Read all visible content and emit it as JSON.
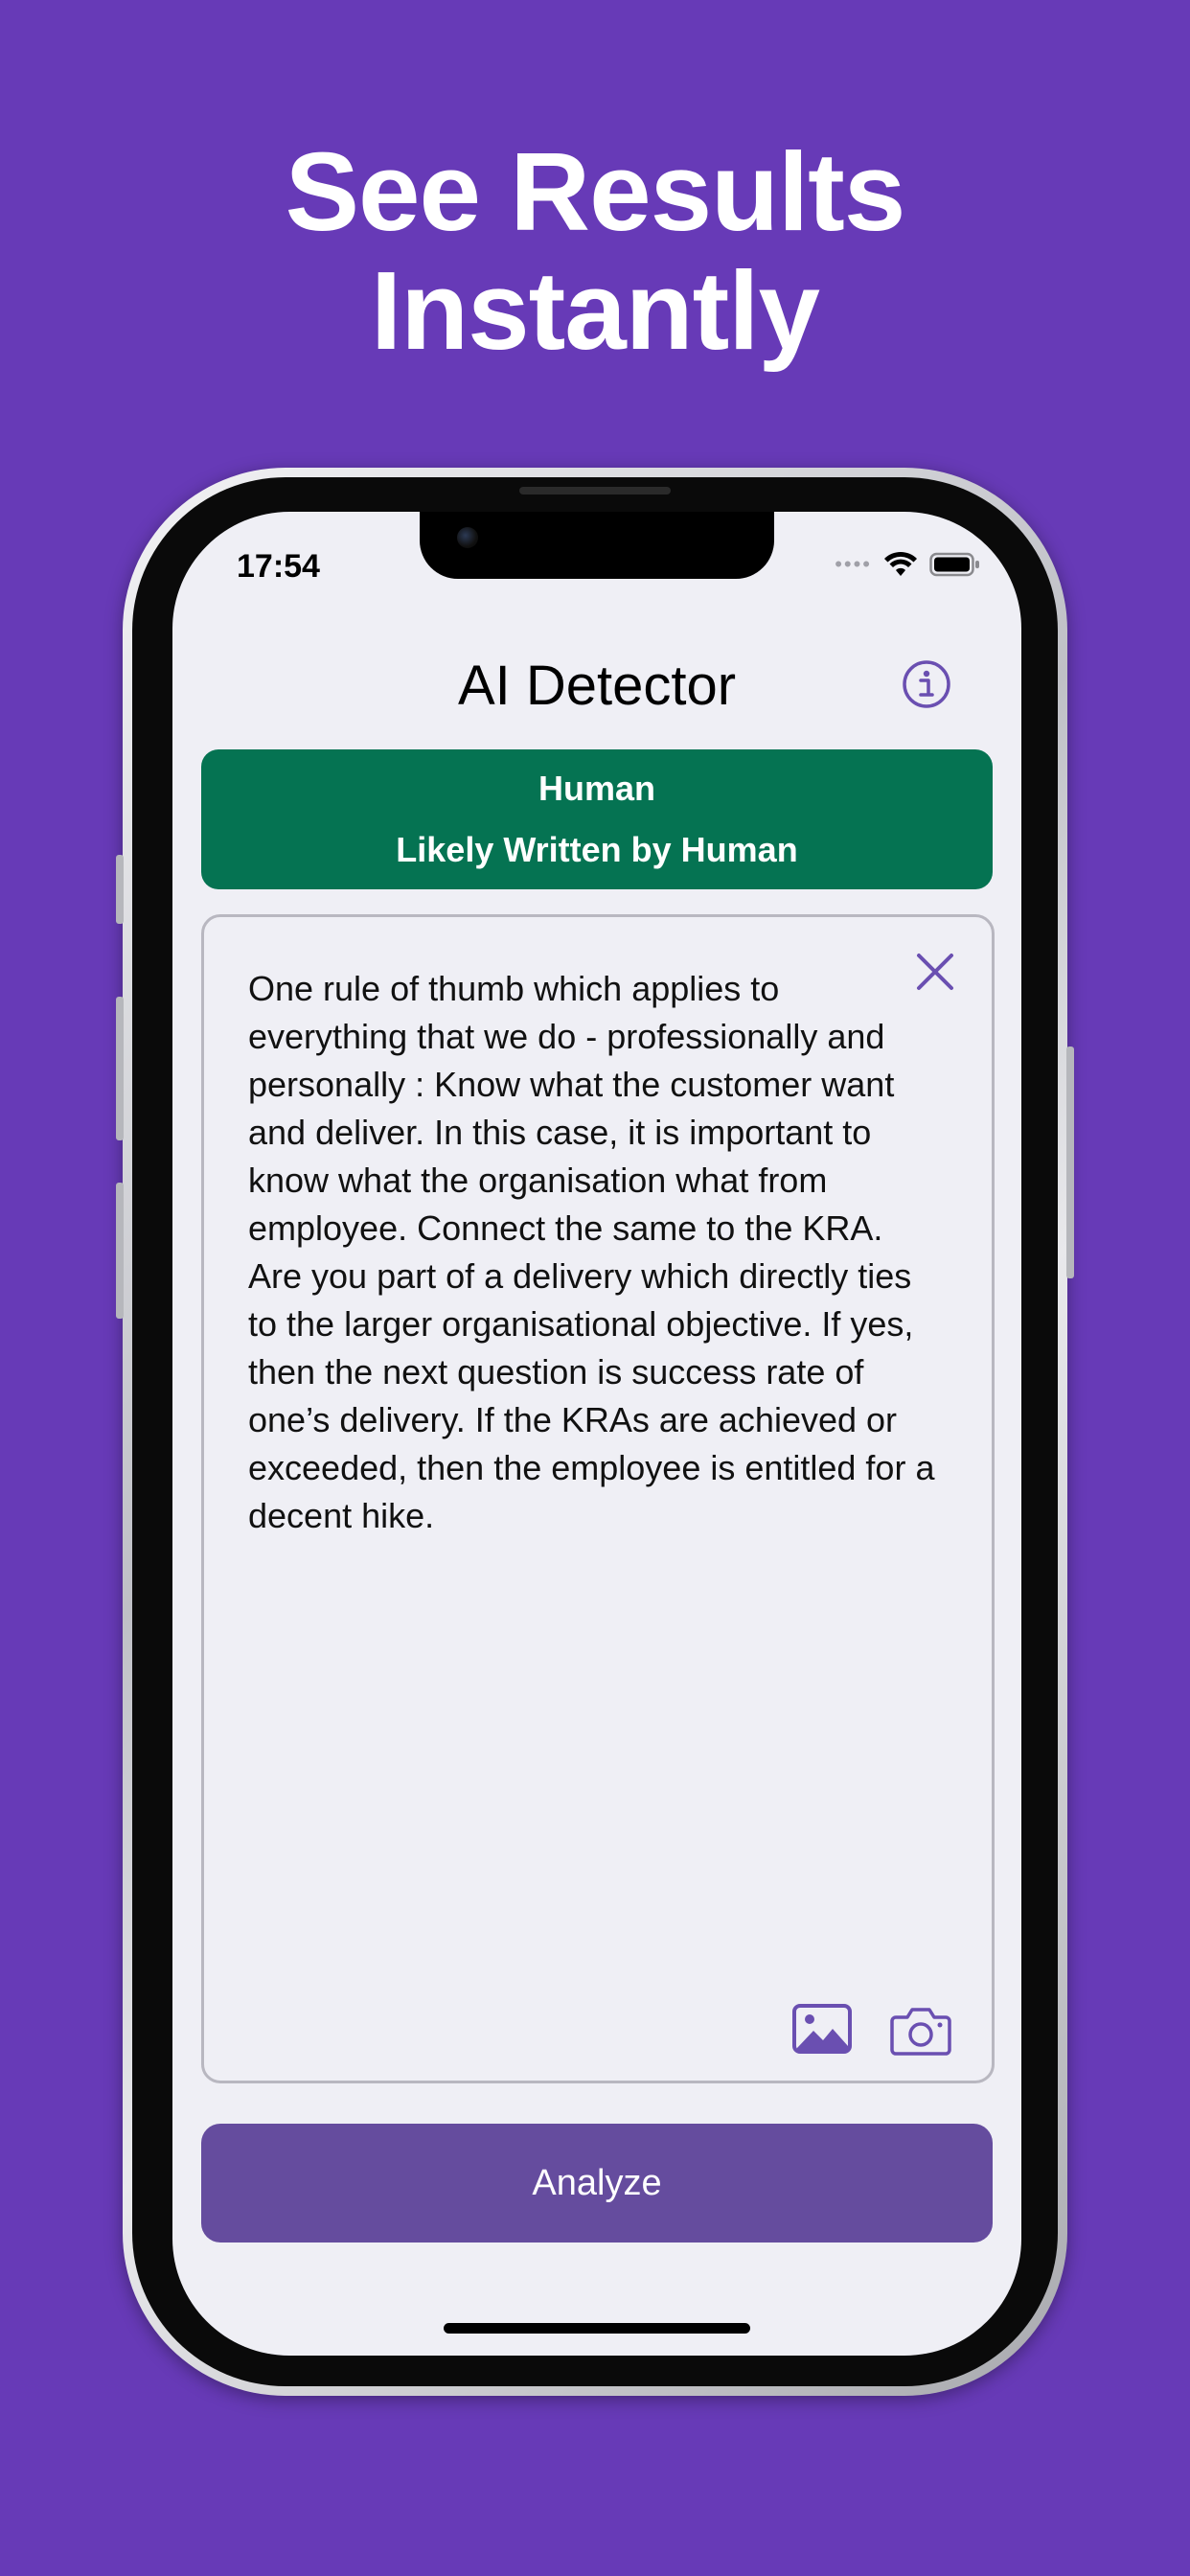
{
  "promo": {
    "headline_line1": "See Results",
    "headline_line2": "Instantly",
    "background_color": "#673ab7"
  },
  "status_bar": {
    "time": "17:54",
    "icons": [
      "cellular-signal-icon",
      "wifi-icon",
      "battery-icon"
    ]
  },
  "nav": {
    "title": "AI Detector",
    "info_icon": "info-circle-icon"
  },
  "result": {
    "label": "Human",
    "description": "Likely Written by Human",
    "color": "#057352"
  },
  "input": {
    "text": "One rule of thumb which applies to everything that we do - professionally and personally : Know what the customer want and deliver. In this case, it is important to know what the organisation what from employee. Connect the same to the KRA. Are you part of a delivery which directly ties to the larger organisational objective. If yes, then the next question is success rate of one’s delivery. If the KRAs are achieved or exceeded, then the employee is entitled for a decent hike.",
    "clear_icon": "close-icon",
    "photo_icon": "photo-icon",
    "camera_icon": "camera-icon"
  },
  "actions": {
    "analyze_label": "Analyze",
    "accent_color": "#654c9e"
  }
}
